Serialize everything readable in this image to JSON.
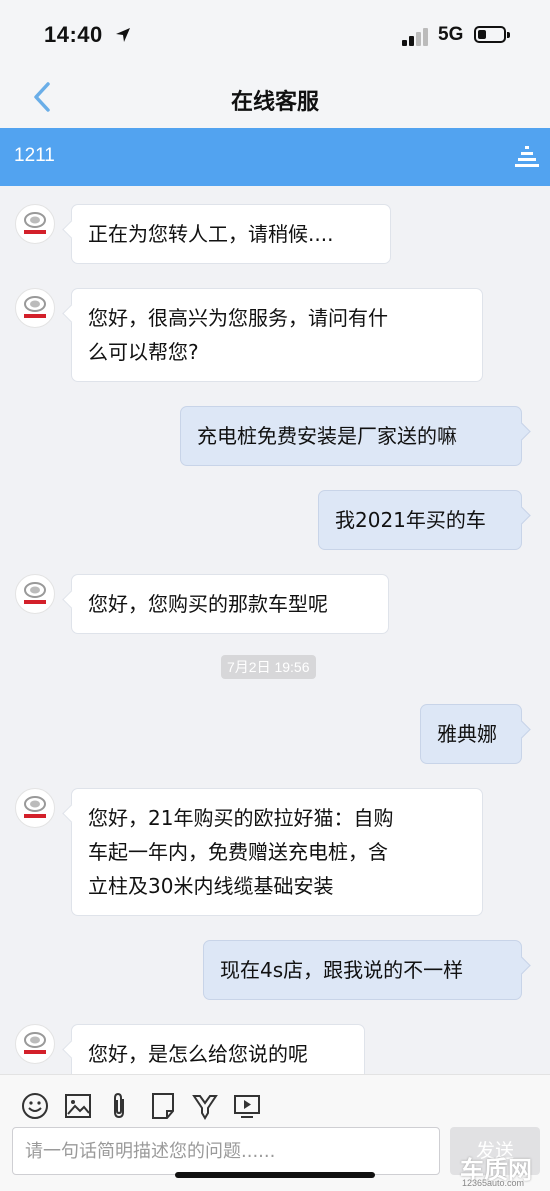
{
  "status_bar": {
    "time": "14:40",
    "network": "5G",
    "battery_level": 0.35
  },
  "nav": {
    "title": "在线客服"
  },
  "session": {
    "id": "1211"
  },
  "messages": [
    {
      "from": "agent",
      "text": "正在为您转人工，请稍候...."
    },
    {
      "from": "agent",
      "lines": [
        "您好，很高兴为您服务，请问有什",
        "么可以帮您?"
      ]
    },
    {
      "from": "user",
      "text": "充电桩免费安装是厂家送的嘛"
    },
    {
      "from": "user",
      "text": "我2021年买的车"
    },
    {
      "from": "agent",
      "text": "您好，您购买的那款车型呢"
    },
    {
      "type": "timestamp",
      "text": "7月2日 19:56"
    },
    {
      "from": "user",
      "text": "雅典娜"
    },
    {
      "from": "agent",
      "lines": [
        "您好，21年购买的欧拉好猫：自购",
        "车起一年内，免费赠送充电桩，含",
        "立柱及30米内线缆基础安装"
      ]
    },
    {
      "from": "user",
      "text": "现在4s店，跟我说的不一样"
    },
    {
      "from": "agent",
      "text": "您好，是怎么给您说的呢"
    }
  ],
  "toolbar": {
    "icons": [
      "smiley-icon",
      "image-icon",
      "paperclip-icon",
      "document-icon",
      "evaluate-icon",
      "video-icon"
    ],
    "input_placeholder": "请一句话简明描述您的问题......",
    "send_label": "发送"
  },
  "watermark": {
    "text": "车质网",
    "sub": "12365auto.com"
  },
  "colors": {
    "header_blue": "#52a3f0",
    "agent_bubble": "#ffffff",
    "user_bubble": "#dde7f6",
    "background": "#f1f2f5",
    "logo_red": "#d3202a"
  }
}
